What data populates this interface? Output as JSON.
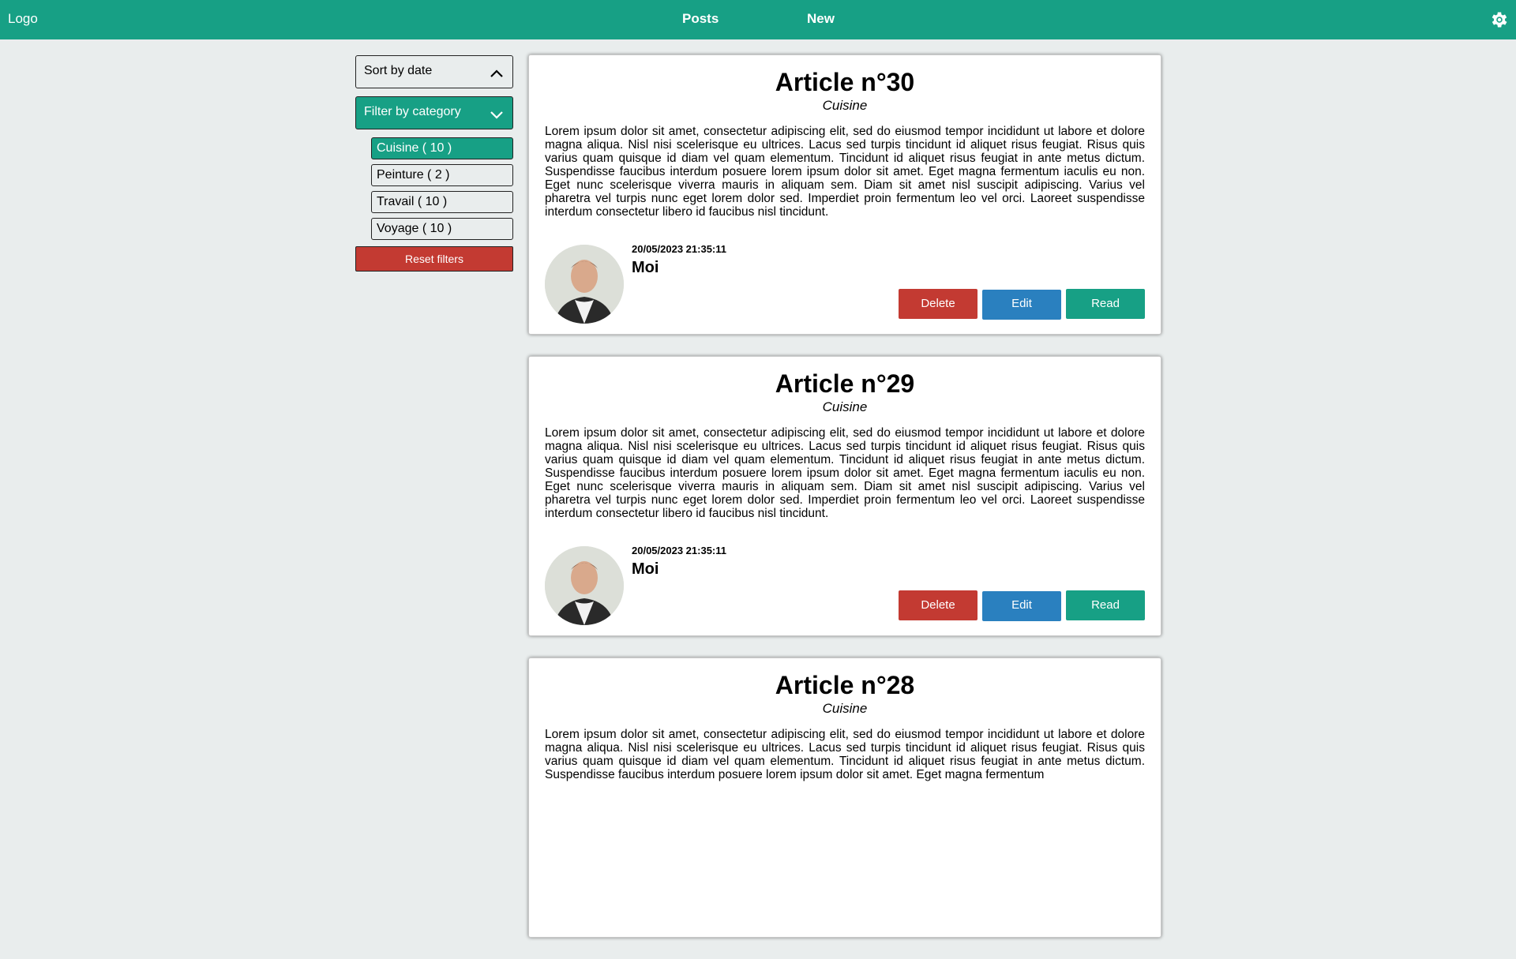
{
  "header": {
    "logo": "Logo",
    "nav": [
      "Posts",
      "New"
    ],
    "settings_icon": "gear-icon"
  },
  "sidebar": {
    "sort_label": "Sort by date",
    "filter_label": "Filter by category",
    "categories": [
      {
        "label": "Cuisine ( 10 )",
        "active": true
      },
      {
        "label": "Peinture ( 2 )",
        "active": false
      },
      {
        "label": "Travail ( 10 )",
        "active": false
      },
      {
        "label": "Voyage ( 10 )",
        "active": false
      }
    ],
    "reset_label": "Reset filters"
  },
  "articles": [
    {
      "title": "Article n°30",
      "category": "Cuisine",
      "body": "Lorem ipsum dolor sit amet, consectetur adipiscing elit, sed do eiusmod tempor incididunt ut labore et dolore magna aliqua. Nisl nisi scelerisque eu ultrices. Lacus sed turpis tincidunt id aliquet risus feugiat. Risus quis varius quam quisque id diam vel quam elementum. Tincidunt id aliquet risus feugiat in ante metus dictum. Suspendisse faucibus interdum posuere lorem ipsum dolor sit amet. Eget magna fermentum iaculis eu non. Eget nunc scelerisque viverra mauris in aliquam sem. Diam sit amet nisl suscipit adipiscing. Varius vel pharetra vel turpis nunc eget lorem dolor sed. Imperdiet proin fermentum leo vel orci. Laoreet suspendisse interdum consectetur libero id faucibus nisl tincidunt.",
      "date": "20/05/2023 21:35:11",
      "author": "Moi",
      "delete_label": "Delete",
      "edit_label": "Edit",
      "read_label": "Read"
    },
    {
      "title": "Article n°29",
      "category": "Cuisine",
      "body": "Lorem ipsum dolor sit amet, consectetur adipiscing elit, sed do eiusmod tempor incididunt ut labore et dolore magna aliqua. Nisl nisi scelerisque eu ultrices. Lacus sed turpis tincidunt id aliquet risus feugiat. Risus quis varius quam quisque id diam vel quam elementum. Tincidunt id aliquet risus feugiat in ante metus dictum. Suspendisse faucibus interdum posuere lorem ipsum dolor sit amet. Eget magna fermentum iaculis eu non. Eget nunc scelerisque viverra mauris in aliquam sem. Diam sit amet nisl suscipit adipiscing. Varius vel pharetra vel turpis nunc eget lorem dolor sed. Imperdiet proin fermentum leo vel orci. Laoreet suspendisse interdum consectetur libero id faucibus nisl tincidunt.",
      "date": "20/05/2023 21:35:11",
      "author": "Moi",
      "delete_label": "Delete",
      "edit_label": "Edit",
      "read_label": "Read"
    },
    {
      "title": "Article n°28",
      "category": "Cuisine",
      "body": "Lorem ipsum dolor sit amet, consectetur adipiscing elit, sed do eiusmod tempor incididunt ut labore et dolore magna aliqua. Nisl nisi scelerisque eu ultrices. Lacus sed turpis tincidunt id aliquet risus feugiat. Risus quis varius quam quisque id diam vel quam elementum. Tincidunt id aliquet risus feugiat in ante metus dictum. Suspendisse faucibus interdum posuere lorem ipsum dolor sit amet. Eget magna fermentum",
      "date": "",
      "author": "",
      "delete_label": "",
      "edit_label": "",
      "read_label": ""
    }
  ],
  "colors": {
    "accent": "#17a085",
    "danger": "#c33a32",
    "info": "#2a80bf",
    "background": "#e9eded"
  }
}
